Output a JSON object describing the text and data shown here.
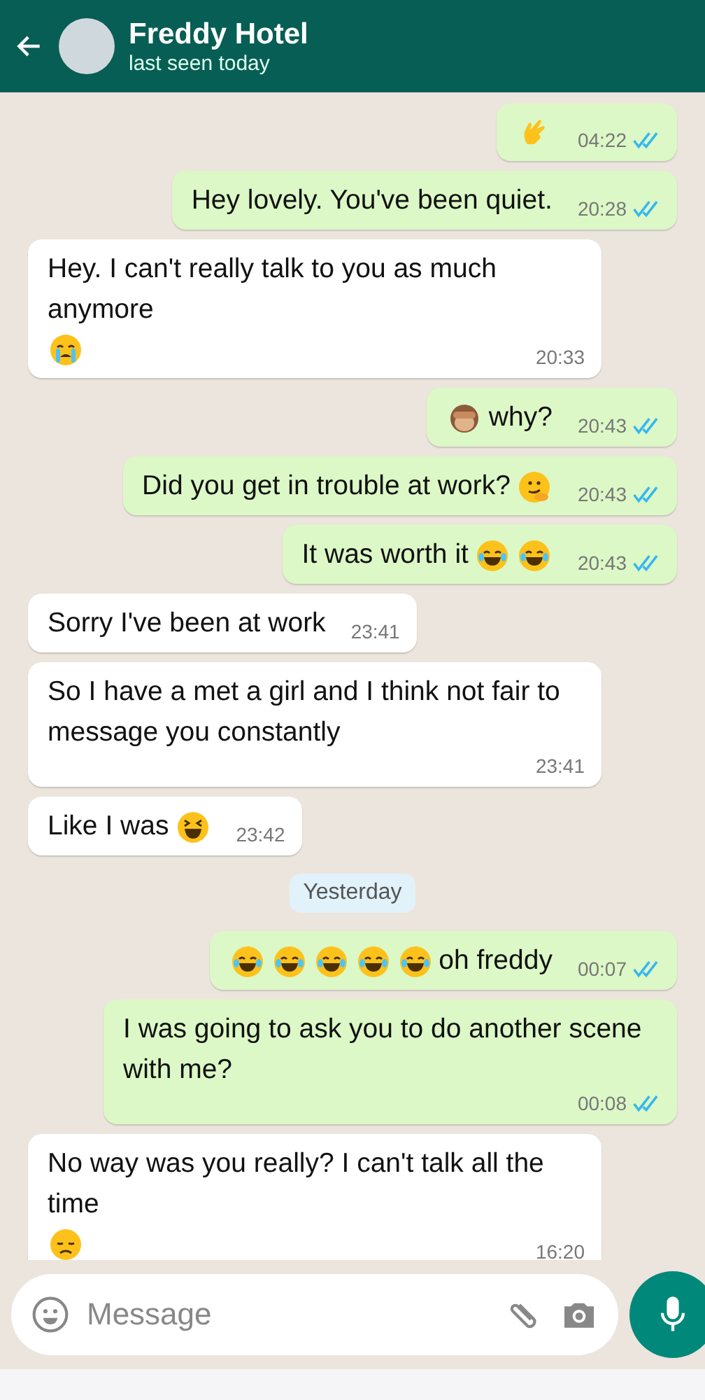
{
  "header": {
    "contact_name": "Freddy Hotel",
    "status": "last seen today"
  },
  "messages": [
    {
      "kind": "sent",
      "parts": [
        {
          "kind": "hand-emoji"
        }
      ],
      "time": "04:22",
      "read": true
    },
    {
      "kind": "sent",
      "parts": [
        {
          "kind": "text",
          "text": "Hey lovely. You've been quiet."
        }
      ],
      "time": "20:28",
      "read": true
    },
    {
      "kind": "received",
      "parts": [
        {
          "kind": "text",
          "text": "Hey. I can't really talk to you as much anymore"
        },
        {
          "kind": "crying-emoji"
        }
      ],
      "time": "20:33"
    },
    {
      "kind": "sent",
      "parts": [
        {
          "kind": "monkey-emoji"
        },
        {
          "kind": "text",
          "text": "why?"
        }
      ],
      "time": "20:43",
      "read": true
    },
    {
      "kind": "sent",
      "parts": [
        {
          "kind": "text",
          "text": "Did you get in trouble at work?"
        },
        {
          "kind": "smirk-emoji"
        }
      ],
      "time": "20:43",
      "read": true
    },
    {
      "kind": "sent",
      "parts": [
        {
          "kind": "text",
          "text": "It was worth it"
        },
        {
          "kind": "joy-emoji"
        },
        {
          "kind": "joy-emoji"
        }
      ],
      "time": "20:43",
      "read": true
    },
    {
      "kind": "received",
      "parts": [
        {
          "kind": "text",
          "text": "Sorry I've been at work"
        }
      ],
      "time": "23:41"
    },
    {
      "kind": "received",
      "parts": [
        {
          "kind": "text",
          "text": "So I have a met a girl and I think not fair to message you constantly"
        }
      ],
      "time": "23:41"
    },
    {
      "kind": "received",
      "parts": [
        {
          "kind": "text",
          "text": "Like I was"
        },
        {
          "kind": "laugh-emoji"
        }
      ],
      "time": "23:42"
    },
    {
      "kind": "date",
      "text": "Yesterday"
    },
    {
      "kind": "sent",
      "parts": [
        {
          "kind": "joy-emoji"
        },
        {
          "kind": "joy-emoji"
        },
        {
          "kind": "joy-emoji"
        },
        {
          "kind": "joy-emoji"
        },
        {
          "kind": "joy-emoji"
        },
        {
          "kind": "text",
          "text": "oh freddy"
        }
      ],
      "time": "00:07",
      "read": true
    },
    {
      "kind": "sent",
      "parts": [
        {
          "kind": "text",
          "text": "I was going to ask you to do another scene with me?"
        }
      ],
      "time": "00:08",
      "read": true
    },
    {
      "kind": "received",
      "parts": [
        {
          "kind": "text",
          "text": "No way was you really? I can't talk all the time"
        },
        {
          "kind": "sad-emoji"
        }
      ],
      "time": "16:20"
    }
  ],
  "composer": {
    "placeholder": "Message"
  }
}
